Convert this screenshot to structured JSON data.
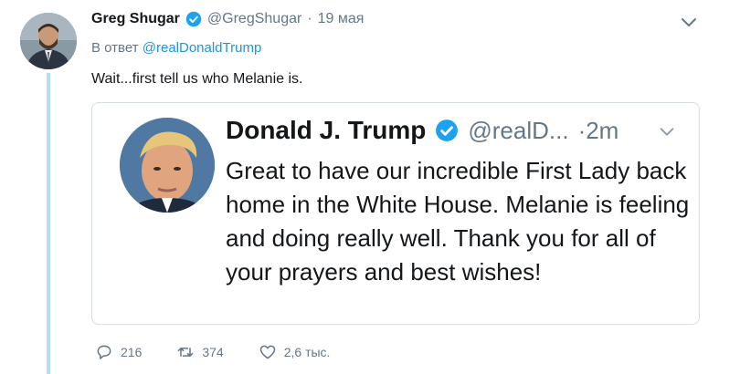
{
  "tweet": {
    "author_name": "Greg Shugar",
    "author_handle": "@GregShugar",
    "separator": "·",
    "date": "19 мая",
    "reply_prefix": "В ответ",
    "reply_mention": "@realDonaldTrump",
    "text": "Wait...first tell us who Melanie is."
  },
  "quoted": {
    "author_name": "Donald J. Trump",
    "author_handle": "@realD...",
    "time": "·2m",
    "text": "Great to have our incredible First Lady back home in the White House. Melanie is feeling and doing really well. Thank you for all of your prayers and best wishes!"
  },
  "actions": {
    "replies": "216",
    "retweets": "374",
    "likes": "2,6 тыс."
  },
  "colors": {
    "accent": "#1b95e0",
    "muted": "#657786",
    "thread_line": "#b9dcf5",
    "verified": "#1da1f2"
  },
  "icons": [
    "verified-badge-icon",
    "chevron-down-icon",
    "reply-icon",
    "retweet-icon",
    "like-icon"
  ]
}
